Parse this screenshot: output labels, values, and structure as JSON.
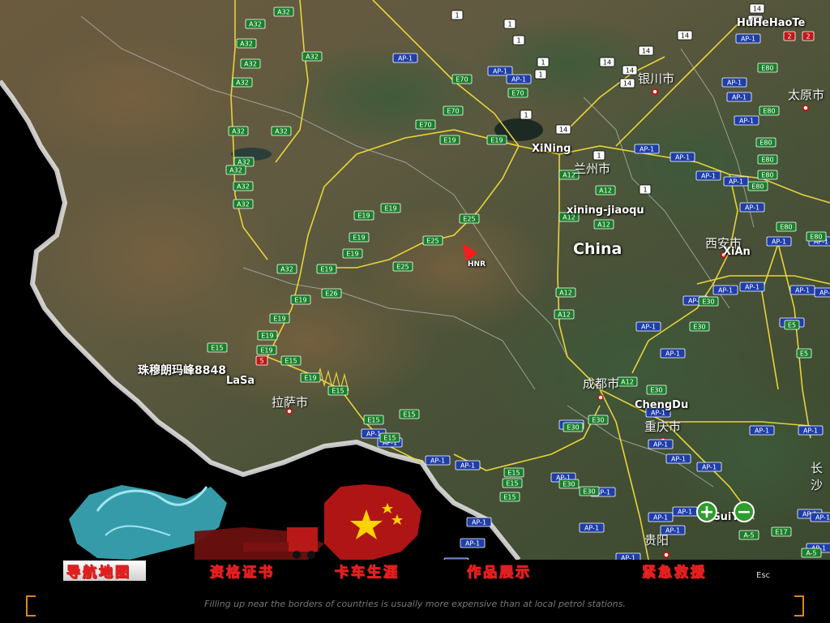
{
  "map": {
    "cities": [
      {
        "id": "huhehaote",
        "name": "HuHeHaoTe"
      },
      {
        "id": "xining",
        "name": "XiNing"
      },
      {
        "id": "xining-jiaoqu",
        "name": "xining-jiaoqu"
      },
      {
        "id": "xian",
        "name": "XiAn"
      },
      {
        "id": "chengdu",
        "name": "ChengDu"
      },
      {
        "id": "lasa",
        "name": "LaSa"
      },
      {
        "id": "guiyang",
        "name": "GuiYa"
      }
    ],
    "country_label": "China",
    "player_marker_label": "HNR",
    "landmark_label": "珠穆朗玛峰8848",
    "chinese_map_labels": [
      "银川市",
      "太原市",
      "兰州市",
      "西安市",
      "拉萨市",
      "成都市",
      "重庆市",
      "贵阳",
      "长沙"
    ],
    "road_shields": [
      "AP-1",
      "A12",
      "A32",
      "E15",
      "E17",
      "E19",
      "E25",
      "E26",
      "E30",
      "E5",
      "E70",
      "E80",
      "A-5",
      "1",
      "14",
      "2",
      "5"
    ],
    "accent_colors": {
      "road": "#e8d23a",
      "ap_shield": "#1f3ea8",
      "e_shield": "#1b7f2a",
      "a_shield": "#1b7f2a",
      "marker": "#ff1a1a"
    }
  },
  "zoom": {
    "in_label": "+",
    "out_label": "−"
  },
  "menu": {
    "items": [
      {
        "id": "nav-map",
        "label": "导航地图"
      },
      {
        "id": "certificate",
        "label": "资格证书"
      },
      {
        "id": "career",
        "label": "卡车生涯"
      },
      {
        "id": "works",
        "label": "作品展示"
      },
      {
        "id": "rescue",
        "label": "紧急救援"
      }
    ],
    "esc_label": "Esc"
  },
  "tip": {
    "text": "Filling up near the borders of countries is usually more expensive than at local petrol stations."
  }
}
